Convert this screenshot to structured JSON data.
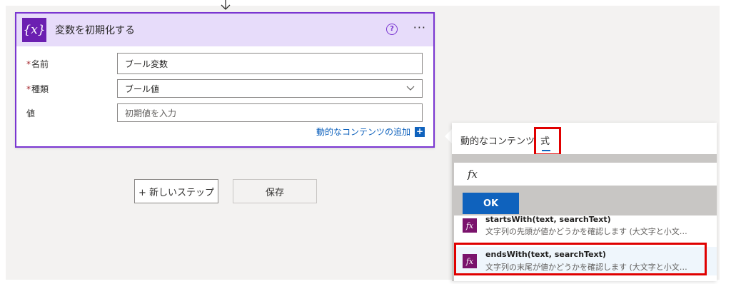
{
  "card": {
    "title": "変数を初期化する",
    "icon_text": "{x}",
    "help_icon": "?",
    "more_icon": "···",
    "fields": {
      "name": {
        "label": "名前",
        "required": "*",
        "value": "ブール変数"
      },
      "type": {
        "label": "種類",
        "required": "*",
        "value": "ブール値"
      },
      "value": {
        "label": "値",
        "placeholder": "初期値を入力"
      }
    },
    "dynamic_link": "動的なコンテンツの追加",
    "dynamic_plus": "+"
  },
  "actions": {
    "new_step": "+ 新しいステップ",
    "save": "保存"
  },
  "panel": {
    "tabs": {
      "dynamic": "動的なコンテンツ",
      "expression": "式"
    },
    "fx_label": "fx",
    "ok": "OK",
    "functions": [
      {
        "icon": "fx",
        "signature": "startsWith(text, searchText)",
        "description": "文字列の先頭が値かどうかを確認します (大文字と小文…"
      },
      {
        "icon": "fx",
        "signature": "endsWith(text, searchText)",
        "description": "文字列の末尾が値かどうかを確認します (大文字と小文…"
      }
    ]
  },
  "colors": {
    "accent": "#7a36d1",
    "header_bg": "#e7dcfa",
    "link": "#0f62bd",
    "highlight": "#e00000",
    "function_icon": "#7a136c"
  }
}
